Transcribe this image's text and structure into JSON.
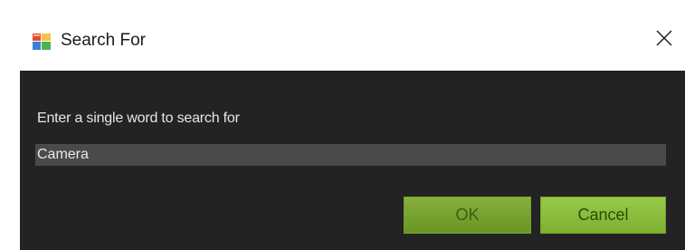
{
  "dialog": {
    "title": "Search For",
    "icon": "application-window-icon",
    "close_icon": "close-icon",
    "prompt": "Enter a single word to search for",
    "input_value": "Camera",
    "ok_label": "OK",
    "cancel_label": "Cancel"
  },
  "colors": {
    "background": "#232323",
    "titlebar": "#ffffff",
    "input": "#4a4a4a",
    "button_accent": "#86b03a"
  }
}
